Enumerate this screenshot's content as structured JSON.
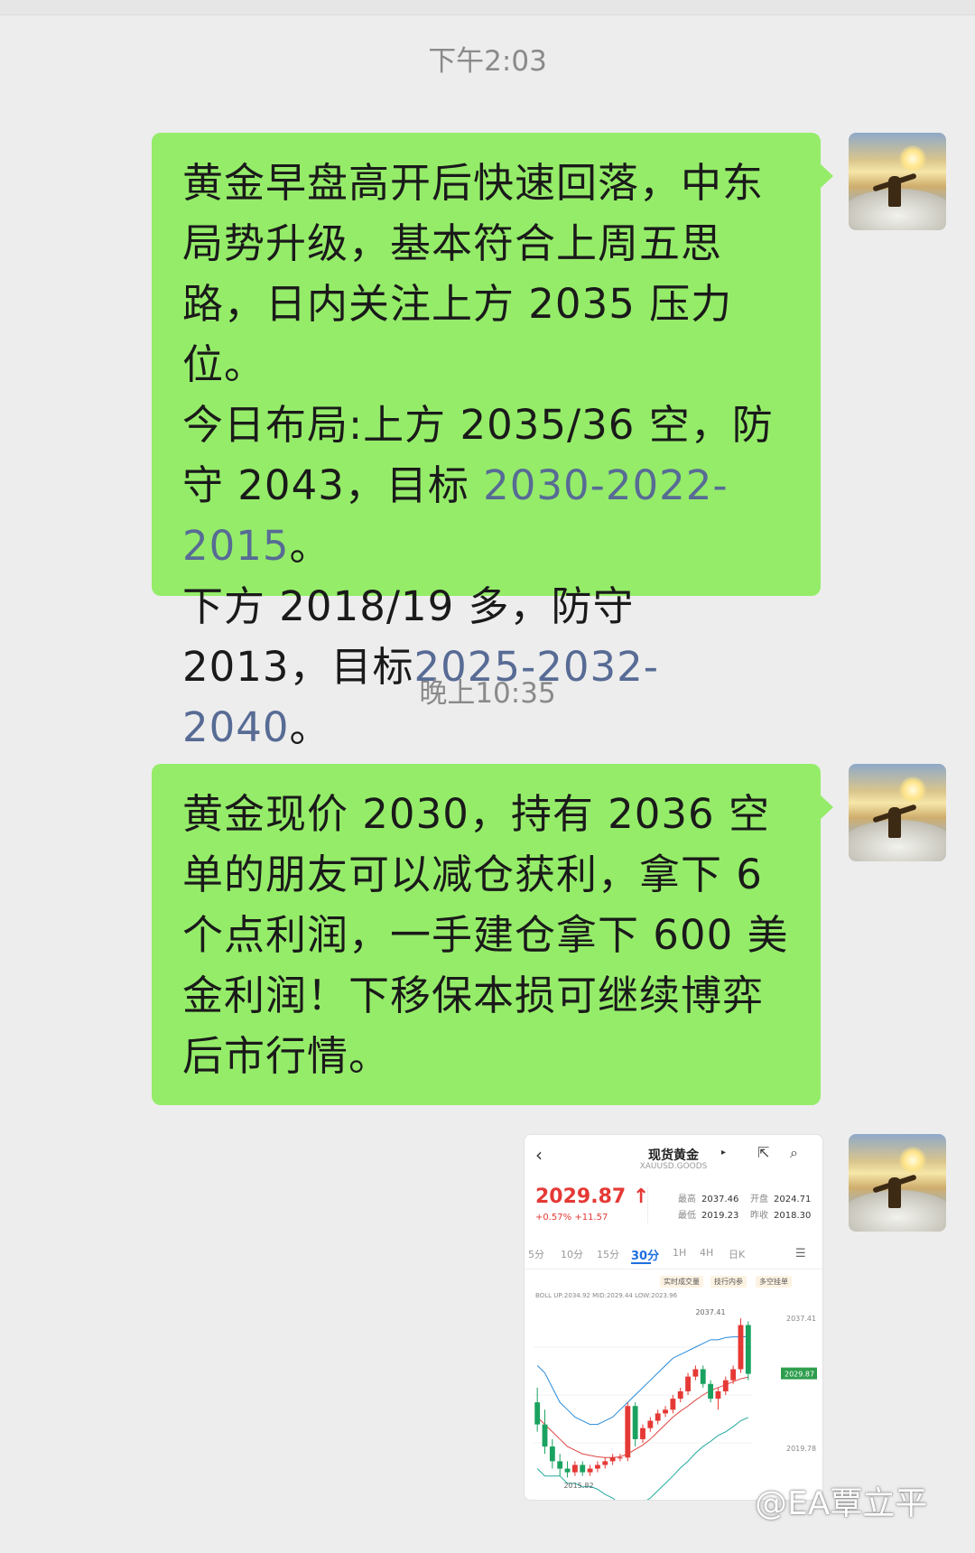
{
  "messages": [
    {
      "time": "下午2:03",
      "paragraphs": [
        {
          "text": "黄金早盘高开后快速回落，中东局势升级，基本符合上周五思路，日内关注上方 2035 压力位。"
        },
        {
          "pre": "今日布局:上方 2035/36 空，防守 2043，目标 ",
          "link": "2030-2022-2015",
          "post": "。"
        },
        {
          "pre": "下方 2018/19 多，防守 2013，目标",
          "link": "2025-2032-2040",
          "post": "。"
        }
      ]
    },
    {
      "time": "晚上10:35",
      "paragraphs": [
        {
          "text": "黄金现价 2030，持有 2036 空单的朋友可以减仓获利，拿下 6 个点利润，一手建仓拿下 600 美金利润！下移保本损可继续博弈后市行情。"
        }
      ]
    }
  ],
  "chart_card": {
    "title": "现货黄金",
    "subtitle": "XAUUSD.GOODS",
    "price": "2029.87 ↑",
    "change": "+0.57%  +11.57",
    "stats": {
      "high_label": "最高",
      "high": "2037.46",
      "open_label": "开盘",
      "open": "2024.71",
      "low_label": "最低",
      "low": "2019.23",
      "prev_label": "昨收",
      "prev": "2018.30"
    },
    "tabs": [
      "5分",
      "10分",
      "15分",
      "30分",
      "1H",
      "4H",
      "日K"
    ],
    "chips": [
      "实时成交量",
      "技行内参",
      "多空挂单"
    ],
    "indicator": "BOLL  UP:2034.92  MID:2029.44  LOW:2023.96",
    "colors": {
      "up": "#e53935",
      "down": "#1aa260",
      "accent": "#1e6fe0"
    }
  },
  "chart_data": {
    "type": "candlestick",
    "axis_labels": [
      "2037.41",
      "2029.87",
      "2019.78"
    ],
    "annotations": [
      "2037.41",
      "2015.82"
    ],
    "ylim": [
      2014,
      2040
    ],
    "candles": [
      [
        2026,
        2028,
        2022,
        2023
      ],
      [
        2023,
        2025,
        2019,
        2020
      ],
      [
        2020,
        2021,
        2017,
        2018
      ],
      [
        2018,
        2019,
        2016,
        2017
      ],
      [
        2017,
        2018,
        2015.8,
        2016.5
      ],
      [
        2016.5,
        2018,
        2016,
        2017.5
      ],
      [
        2017.5,
        2018,
        2016,
        2016.5
      ],
      [
        2016.5,
        2017.5,
        2016,
        2017
      ],
      [
        2017,
        2018,
        2016.5,
        2017.5
      ],
      [
        2017.5,
        2018.5,
        2017,
        2018
      ],
      [
        2018,
        2019,
        2017.5,
        2018.5
      ],
      [
        2018.5,
        2019,
        2018,
        2018.5
      ],
      [
        2018.5,
        2026,
        2018,
        2025.5
      ],
      [
        2025.5,
        2026,
        2020,
        2021
      ],
      [
        2021,
        2023,
        2020.5,
        2022.5
      ],
      [
        2022.5,
        2024,
        2022,
        2023.5
      ],
      [
        2023.5,
        2025,
        2023,
        2024.5
      ],
      [
        2024.5,
        2025.5,
        2024,
        2025
      ],
      [
        2025,
        2027,
        2024.5,
        2026.5
      ],
      [
        2026.5,
        2028,
        2026,
        2027.5
      ],
      [
        2027.5,
        2030,
        2027,
        2029.5
      ],
      [
        2029.5,
        2031,
        2029,
        2030.5
      ],
      [
        2030.5,
        2031,
        2028,
        2028.5
      ],
      [
        2028.5,
        2029,
        2026,
        2026.5
      ],
      [
        2026.5,
        2028,
        2025,
        2027.5
      ],
      [
        2027.5,
        2029.5,
        2027,
        2029
      ],
      [
        2029,
        2031,
        2028.5,
        2030.5
      ],
      [
        2030.5,
        2037.41,
        2030,
        2036.5
      ],
      [
        2036.5,
        2037,
        2029,
        2029.87
      ]
    ],
    "boll_up": [
      2031,
      2030,
      2028,
      2026,
      2025,
      2024,
      2023.5,
      2023,
      2023,
      2023.5,
      2024,
      2025,
      2026,
      2027,
      2028,
      2029,
      2030,
      2031,
      2032,
      2032.5,
      2033,
      2033.5,
      2034,
      2034.5,
      2034.5,
      2034.8,
      2034.9,
      2034.9,
      2034.92
    ],
    "boll_mid": [
      2024,
      2023,
      2022,
      2021,
      2020,
      2019.5,
      2019,
      2018.8,
      2018.6,
      2018.5,
      2018.5,
      2018.6,
      2019,
      2019.6,
      2020.2,
      2021,
      2022,
      2023,
      2024,
      2024.8,
      2025.5,
      2026.3,
      2027,
      2027.6,
      2028,
      2028.4,
      2028.8,
      2029.2,
      2029.44
    ]
  }
}
